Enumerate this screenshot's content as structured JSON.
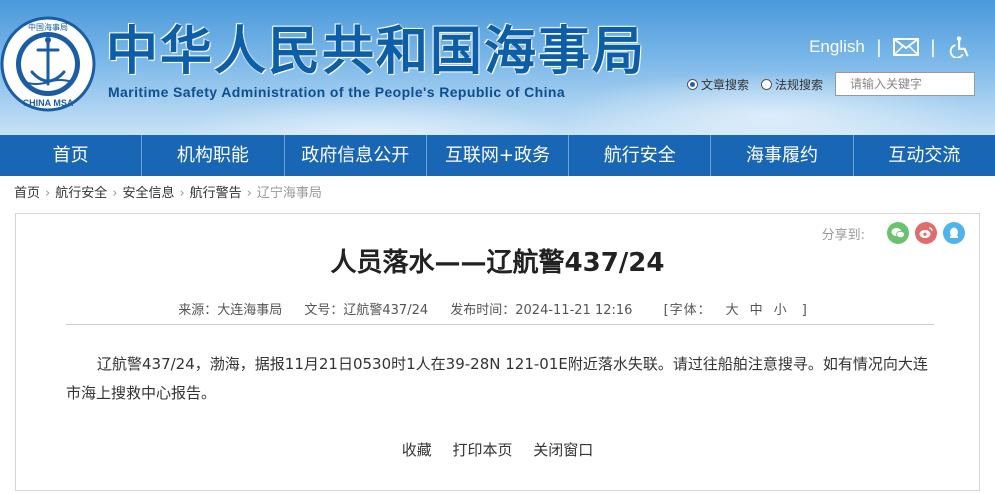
{
  "header": {
    "logo_text_top": "中国海事局",
    "logo_text_bottom": "CHINA MSA",
    "title_cn": "中华人民共和国海事局",
    "title_en": "Maritime Safety Administration of the People's Republic of China",
    "lang_link": "English",
    "icons": [
      "mail-icon",
      "accessibility-icon"
    ],
    "search": {
      "radio_options": [
        "文章搜索",
        "法规搜索"
      ],
      "selected": "文章搜索",
      "placeholder": "请输入关键字"
    }
  },
  "nav": {
    "items": [
      "首页",
      "机构职能",
      "政府信息公开",
      "互联网+政务",
      "航行安全",
      "海事履约",
      "互动交流"
    ]
  },
  "breadcrumb": {
    "items": [
      "首页",
      "航行安全",
      "安全信息",
      "航行警告",
      "辽宁海事局"
    ]
  },
  "article": {
    "share_label": "分享到:",
    "share_icons": [
      "wechat-icon",
      "weibo-icon",
      "qq-icon"
    ],
    "title": "人员落水——辽航警437/24",
    "meta": {
      "source": "来源：大连海事局",
      "doc_no": "文号：辽航警437/24",
      "publish_time": "发布时间：2024-11-21 12:16",
      "font_label": "[字体：",
      "font_sizes": [
        "大",
        "中",
        "小"
      ],
      "font_close": "]"
    },
    "body": "辽航警437/24，渤海，据报11月21日0530时1人在39-28N 121-01E附近落水失联。请过往船舶注意搜寻。如有情况向大连市海上搜救中心报告。",
    "actions": [
      "收藏",
      "打印本页",
      "关闭窗口"
    ]
  },
  "colors": {
    "nav_bg": "#1866b4",
    "title_blue": "#0d5ea8",
    "wechat": "#6ac26f",
    "weibo": "#e06c6c",
    "qq": "#4fb3ee"
  }
}
